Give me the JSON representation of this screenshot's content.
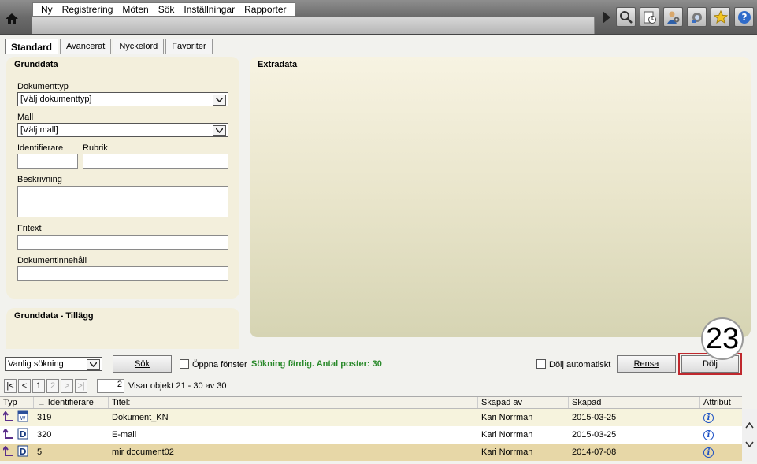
{
  "menu": [
    "Ny",
    "Registrering",
    "Möten",
    "Sök",
    "Inställningar",
    "Rapporter"
  ],
  "toolbar_icons": [
    "play-icon",
    "search-icon",
    "clock-document-icon",
    "user-settings-icon",
    "plugin-gear-icon",
    "favorite-star-icon",
    "help-icon"
  ],
  "tabs": [
    "Standard",
    "Avancerat",
    "Nyckelord",
    "Favoriter"
  ],
  "grunddata": {
    "title": "Grunddata",
    "dokumenttyp_label": "Dokumenttyp",
    "dokumenttyp_value": "[Välj dokumenttyp]",
    "mall_label": "Mall",
    "mall_value": "[Välj mall]",
    "identifierare_label": "Identifierare",
    "rubrik_label": "Rubrik",
    "beskrivning_label": "Beskrivning",
    "fritext_label": "Fritext",
    "dokumentinnehall_label": "Dokumentinnehåll"
  },
  "tillagg": {
    "title": "Grunddata - Tillägg"
  },
  "extradata": {
    "title": "Extradata"
  },
  "search": {
    "mode_value": "Vanlig sökning",
    "search_button": "Sök",
    "open_window_label": "Öppna fönster",
    "status": "Sökning färdig. Antal poster: 30",
    "hide_auto_label": "Dölj automatiskt",
    "clear_button": "Rensa",
    "hide_button": "Dölj"
  },
  "pager": {
    "first": "|<",
    "prev": "<",
    "page1": "1",
    "page2": "2",
    "next": ">",
    "last": ">|",
    "current_page": "2",
    "info": "Visar objekt 21 - 30 av 30"
  },
  "table": {
    "headers": [
      "Typ",
      "Identifierare",
      "Titel:",
      "Skapad av",
      "Skapad",
      "Attribut"
    ],
    "rows": [
      {
        "id": "319",
        "title": "Dokument_KN",
        "created_by": "Kari Norrman",
        "created": "2015-03-25",
        "icon": "word-document-icon"
      },
      {
        "id": "320",
        "title": "E-mail",
        "created_by": "Kari Norrman",
        "created": "2015-03-25",
        "icon": "d-document-icon"
      },
      {
        "id": "5",
        "title": "mir document02",
        "created_by": "Kari Norrman",
        "created": "2014-07-08",
        "icon": "d-document-icon"
      }
    ]
  },
  "badge_number": "23",
  "colors": {
    "status_green": "#2b8a2b",
    "selected_row": "#e7d7a7",
    "highlight_border": "#c0282d"
  }
}
